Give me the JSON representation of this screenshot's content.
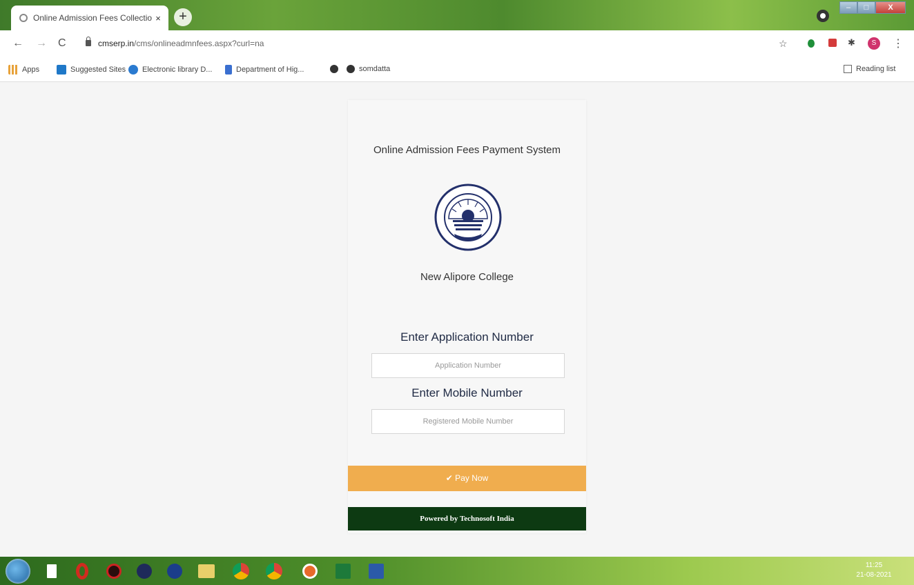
{
  "browser": {
    "tab_title": "Online Admission Fees Collection",
    "tab_close": "×",
    "new_tab": "+",
    "window_close": "X",
    "url_host": "cmserp.in",
    "url_path": "/cms/onlineadmnfees.aspx?curl=na",
    "back": "←",
    "forward": "→",
    "reload": "C",
    "star": "☆",
    "avatar_letter": "S",
    "menu": "⋮",
    "bookmarks": [
      {
        "label": "Apps",
        "color": "#e8a23a"
      },
      {
        "label": "Suggested Sites",
        "color": "#1f78c8"
      },
      {
        "label": "Electronic library D...",
        "color": "#2a7ad0"
      },
      {
        "label": "Department of Hig...",
        "color": "#3a6fd0"
      },
      {
        "label": "",
        "color": "#333333"
      },
      {
        "label": "somdatta",
        "color": "#333333"
      }
    ],
    "reading_list": "Reading list"
  },
  "page": {
    "system_title": "Online Admission Fees Payment System",
    "college_name": "New Alipore College",
    "application_label": "Enter Application Number",
    "application_placeholder": "Application Number",
    "mobile_label": "Enter Mobile Number",
    "mobile_placeholder": "Registered Mobile Number",
    "pay_button": "✔ Pay Now",
    "powered_by": "Powered by Technosoft India"
  },
  "taskbar": {
    "icons": [
      "file-explorer-icon",
      "opera-icon",
      "app-icon",
      "app-icon",
      "folder-icon",
      "chrome-icon",
      "chrome-icon",
      "app-icon",
      "excel-icon",
      "word-icon"
    ],
    "time": "11:25",
    "date": "21-08-2021"
  },
  "colors": {
    "pay_button": "#f0ad4e",
    "powered_bar": "#0d3a12",
    "label_text": "#1f2a44"
  }
}
